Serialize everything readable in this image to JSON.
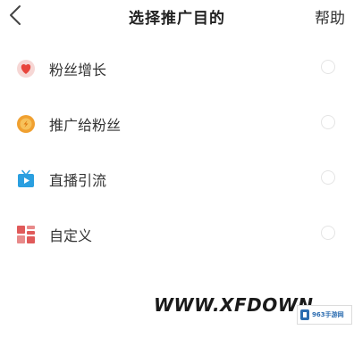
{
  "header": {
    "title": "选择推广目的",
    "help_label": "帮助"
  },
  "options": [
    {
      "label": "粉丝增长",
      "icon": "heart-icon",
      "color": "#e8453c",
      "selected": false
    },
    {
      "label": "推广给粉丝",
      "icon": "coin-icon",
      "color": "#f0a030",
      "selected": false
    },
    {
      "label": "直播引流",
      "icon": "tv-play-icon",
      "color": "#2a9fe0",
      "selected": false
    },
    {
      "label": "自定义",
      "icon": "grid-icon",
      "color": "#e05a5a",
      "selected": false
    }
  ],
  "watermark": {
    "text": "WWW.XFDOWN",
    "badge_text": "963手游网"
  }
}
